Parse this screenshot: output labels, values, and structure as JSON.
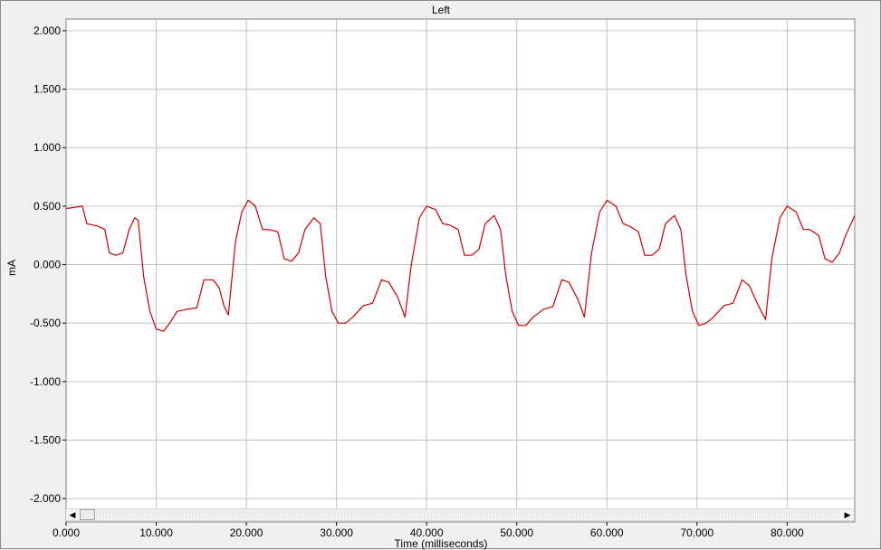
{
  "window_title": "Left",
  "chart_data": {
    "type": "line",
    "title": "Left",
    "xlabel": "Time (milliseconds)",
    "ylabel": "mA",
    "xlim": [
      0,
      87.5
    ],
    "ylim": [
      -2.2,
      2.1
    ],
    "grid": true,
    "x_ticks": [
      "0.000",
      "10.000",
      "20.000",
      "30.000",
      "40.000",
      "50.000",
      "60.000",
      "70.000",
      "80.000"
    ],
    "x_tick_values": [
      0,
      10,
      20,
      30,
      40,
      50,
      60,
      70,
      80
    ],
    "y_ticks": [
      "2.000",
      "1.500",
      "1.000",
      "0.500",
      "0.000",
      "-0.500",
      "-1.000",
      "-1.500",
      "-2.000"
    ],
    "y_tick_values": [
      2,
      1.5,
      1,
      0.5,
      0,
      -0.5,
      -1,
      -1.5,
      -2
    ],
    "series": [
      {
        "color": "#cc0000",
        "x": [
          0,
          1,
          1.8,
          2.3,
          3.5,
          4.3,
          4.8,
          5.5,
          6.3,
          7,
          7.6,
          8,
          8.6,
          9.3,
          10,
          10.8,
          11.5,
          12.3,
          13.5,
          14.5,
          15.3,
          16.3,
          17,
          17.5,
          18,
          18.8,
          19.5,
          20.2,
          21,
          21.8,
          22.5,
          23.5,
          24.2,
          25,
          25.8,
          26.5,
          27.5,
          28.2,
          28.8,
          29.5,
          30.2,
          31,
          31.8,
          33,
          34,
          35,
          35.8,
          36.8,
          37.6,
          38.3,
          39.2,
          40,
          41,
          41.8,
          42.5,
          43.5,
          44.2,
          45,
          45.8,
          46.5,
          47.5,
          48.2,
          48.8,
          49.5,
          50.2,
          51,
          51.8,
          53,
          54,
          55,
          55.8,
          56.8,
          57.5,
          58.3,
          59.2,
          60,
          61,
          61.8,
          62.5,
          63.5,
          64.2,
          65,
          65.8,
          66.5,
          67.5,
          68.2,
          68.8,
          69.5,
          70.2,
          71,
          71.8,
          73,
          74,
          75,
          75.8,
          76.8,
          77.6,
          78.3,
          79.2,
          80,
          81,
          81.8,
          82.5,
          83.5,
          84.2,
          85,
          85.8,
          86.5,
          87.5
        ],
        "values": [
          0.48,
          0.49,
          0.5,
          0.35,
          0.33,
          0.3,
          0.1,
          0.08,
          0.1,
          0.3,
          0.4,
          0.38,
          -0.1,
          -0.4,
          -0.55,
          -0.57,
          -0.5,
          -0.4,
          -0.38,
          -0.37,
          -0.13,
          -0.13,
          -0.2,
          -0.35,
          -0.43,
          0.2,
          0.45,
          0.55,
          0.5,
          0.3,
          0.3,
          0.28,
          0.05,
          0.03,
          0.1,
          0.3,
          0.4,
          0.35,
          -0.1,
          -0.4,
          -0.5,
          -0.5,
          -0.45,
          -0.35,
          -0.33,
          -0.13,
          -0.15,
          -0.28,
          -0.45,
          0.0,
          0.4,
          0.5,
          0.47,
          0.35,
          0.34,
          0.3,
          0.08,
          0.08,
          0.13,
          0.35,
          0.42,
          0.3,
          -0.1,
          -0.4,
          -0.52,
          -0.52,
          -0.45,
          -0.38,
          -0.36,
          -0.13,
          -0.15,
          -0.3,
          -0.45,
          0.1,
          0.45,
          0.55,
          0.5,
          0.35,
          0.33,
          0.28,
          0.08,
          0.08,
          0.13,
          0.35,
          0.42,
          0.3,
          -0.1,
          -0.4,
          -0.52,
          -0.5,
          -0.45,
          -0.35,
          -0.33,
          -0.13,
          -0.18,
          -0.35,
          -0.47,
          0.05,
          0.4,
          0.5,
          0.45,
          0.3,
          0.3,
          0.25,
          0.05,
          0.02,
          0.1,
          0.25,
          0.42
        ]
      }
    ]
  },
  "scrollbar": {
    "left_arrow": "◀",
    "right_arrow": "▶"
  },
  "colors": {
    "background": "#f0f0f0",
    "plot_background": "#ffffff",
    "grid": "#c0c0c0",
    "series": "#cc0000"
  }
}
